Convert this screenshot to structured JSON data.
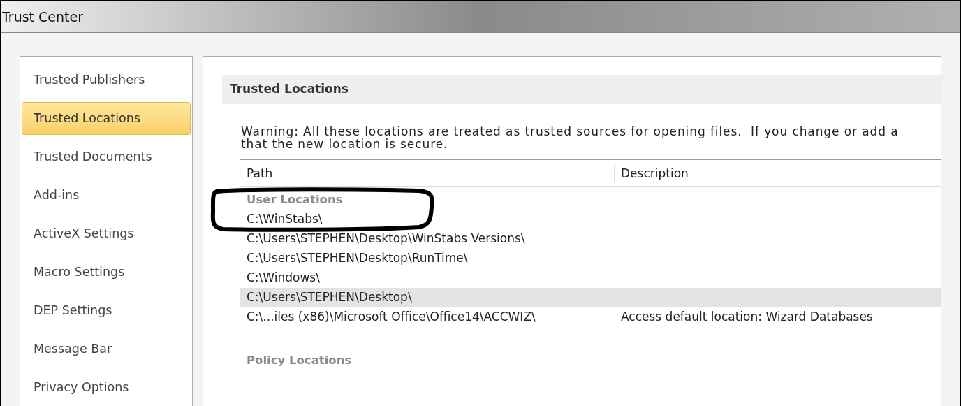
{
  "window": {
    "title": "Trust Center"
  },
  "sidebar": {
    "items": [
      {
        "label": "Trusted Publishers",
        "selected": false
      },
      {
        "label": "Trusted Locations",
        "selected": true
      },
      {
        "label": "Trusted Documents",
        "selected": false
      },
      {
        "label": "Add-ins",
        "selected": false
      },
      {
        "label": "ActiveX Settings",
        "selected": false
      },
      {
        "label": "Macro Settings",
        "selected": false
      },
      {
        "label": "DEP Settings",
        "selected": false
      },
      {
        "label": "Message Bar",
        "selected": false
      },
      {
        "label": "Privacy Options",
        "selected": false
      }
    ]
  },
  "section": {
    "title": "Trusted Locations",
    "warning": [
      "Warning: All these locations are treated as trusted sources for opening files.  If you change or add a",
      "that the new location is secure."
    ]
  },
  "table": {
    "columns": [
      "Path",
      "Description"
    ],
    "rows": [
      {
        "kind": "group",
        "path": "User Locations"
      },
      {
        "kind": "path",
        "path": "C:\\WinStabs\\",
        "selected": false
      },
      {
        "kind": "path",
        "path": "C:\\Users\\STEPHEN\\Desktop\\WinStabs Versions\\",
        "selected": false
      },
      {
        "kind": "path",
        "path": "C:\\Users\\STEPHEN\\Desktop\\RunTime\\",
        "selected": false
      },
      {
        "kind": "path",
        "path": "C:\\Windows\\",
        "selected": false
      },
      {
        "kind": "path",
        "path": "C:\\Users\\STEPHEN\\Desktop\\",
        "selected": true
      },
      {
        "kind": "path",
        "path": "C:\\...iles (x86)\\Microsoft Office\\Office14\\ACCWIZ\\",
        "description": "Access default location: Wizard Databases",
        "selected": false
      },
      {
        "kind": "spacer"
      },
      {
        "kind": "group",
        "path": "Policy Locations"
      }
    ]
  }
}
